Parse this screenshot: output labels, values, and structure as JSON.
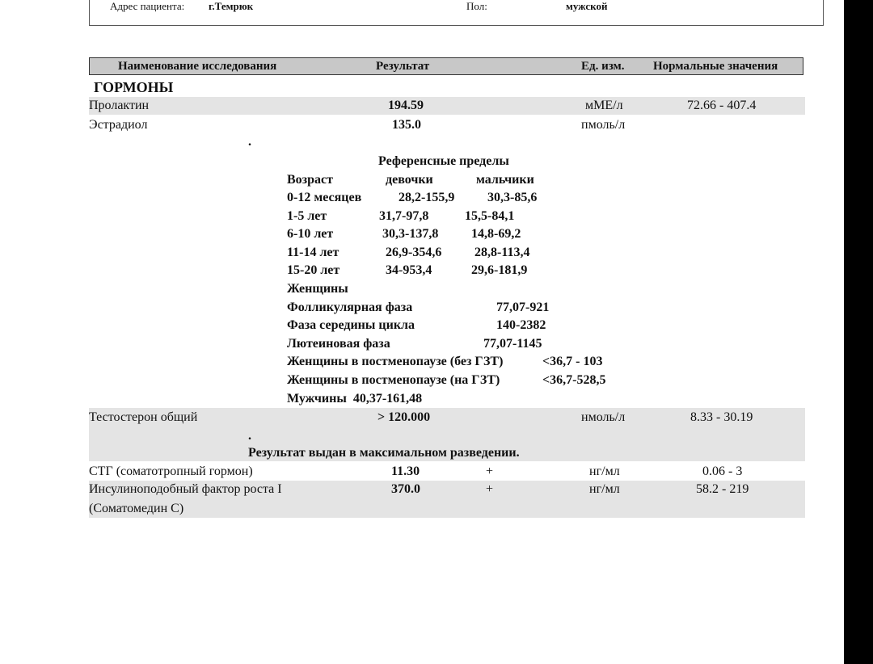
{
  "patient": {
    "address_label": "Адрес пациента:",
    "address_value": "г.Темрюк",
    "sex_label": "Пол:",
    "sex_value": "мужской"
  },
  "table_header": {
    "name": "Наименование исследования",
    "result": "Результат",
    "unit": "Ед. изм.",
    "normal": "Нормальные значения"
  },
  "section_title": "ГОРМОНЫ",
  "rows": {
    "prolactin": {
      "name": "Пролактин",
      "result": "194.59",
      "unit": "мМЕ/л",
      "normal": "72.66 - 407.4"
    },
    "estradiol": {
      "name": "Эстрадиол",
      "result": "135.0",
      "unit": "пмоль/л",
      "normal": ""
    },
    "testosterone": {
      "name": "Тестостерон общий",
      "result": "> 120.000",
      "unit": "нмоль/л",
      "normal": "8.33 - 30.19"
    },
    "stg": {
      "name": "СТГ (соматотропный гормон)",
      "result": "11.30",
      "flag": "+",
      "unit": "нг/мл",
      "normal": "0.06 - 3"
    },
    "igf": {
      "name_line1": "Инсулиноподобный фактор роста I",
      "name_line2": "(Соматомедин С)",
      "result": "370.0",
      "flag": "+",
      "unit": "нг/мл",
      "normal": "58.2 - 219"
    }
  },
  "dot": ".",
  "reference": {
    "title": "Референсные пределы",
    "col_age": "Возраст",
    "col_girls": "девочки",
    "col_boys": "мальчики",
    "ages": [
      {
        "age": "0-12 месяцев",
        "girls": "28,2-155,9",
        "boys": "30,3-85,6"
      },
      {
        "age": "1-5 лет",
        "girls": "31,7-97,8",
        "boys": "15,5-84,1"
      },
      {
        "age": "6-10 лет",
        "girls": "30,3-137,8",
        "boys": "14,8-69,2"
      },
      {
        "age": "11-14 лет",
        "girls": "26,9-354,6",
        "boys": "28,8-113,4"
      },
      {
        "age": "15-20 лет",
        "girls": "34-953,4",
        "boys": "29,6-181,9"
      }
    ],
    "women_label": "Женщины",
    "phases": [
      {
        "label": "Фолликулярная фаза",
        "value": "77,07-921"
      },
      {
        "label": "Фаза середины цикла",
        "value": "140-2382"
      },
      {
        "label": "Лютеиновая фаза",
        "value": "77,07-1145"
      },
      {
        "label": "Женщины в постменопаузе (без ГЗТ)",
        "value": "<36,7 - 103"
      },
      {
        "label": "Женщины в постменопаузе (на ГЗТ)",
        "value": "<36,7-528,5"
      }
    ],
    "men": "Мужчины  40,37-161,48"
  },
  "dilution_note": "Результат выдан в максимальном разведении."
}
